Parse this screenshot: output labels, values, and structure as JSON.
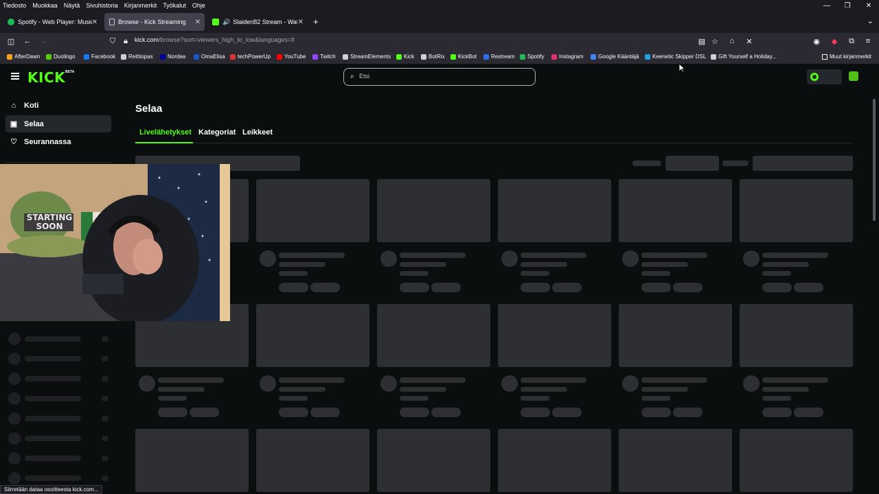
{
  "menubar": {
    "items": [
      "Tiedosto",
      "Muokkaa",
      "Näytä",
      "Sivuhistoria",
      "Kirjanmerkit",
      "Työkalut",
      "Ohje"
    ]
  },
  "tabs": [
    {
      "label": "Spotify - Web Player: Music for",
      "icon": "spotify-icon",
      "active": false
    },
    {
      "label": "Browse - Kick Streaming",
      "icon": "page-icon",
      "active": true
    },
    {
      "label": "Slaideri82 Stream - Watch l",
      "icon": "kick-icon",
      "active": false
    }
  ],
  "urlbar": {
    "host": "kick.com",
    "path": "/browse?sort=viewers_high_to_low&languages=fi"
  },
  "bookmarks": [
    {
      "label": "AfterDawn",
      "color": "#f4a21a"
    },
    {
      "label": "Duolingo",
      "color": "#58cc02"
    },
    {
      "label": "Facebook",
      "color": "#1877f2"
    },
    {
      "label": "Reittiopas",
      "color": "#cfcfd8"
    },
    {
      "label": "Nordea",
      "color": "#0000a0"
    },
    {
      "label": "OmaElisa",
      "color": "#1a57c8"
    },
    {
      "label": "techPowerUp",
      "color": "#d33"
    },
    {
      "label": "YouTube",
      "color": "#ff0000"
    },
    {
      "label": "Twitch",
      "color": "#9146ff"
    },
    {
      "label": "StreamElements",
      "color": "#cfcfd8"
    },
    {
      "label": "Kick",
      "color": "#53fc18"
    },
    {
      "label": "BotRix",
      "color": "#cfcfd8"
    },
    {
      "label": "KickBot",
      "color": "#53fc18"
    },
    {
      "label": "Restream",
      "color": "#2f6fed"
    },
    {
      "label": "Spotify",
      "color": "#1db954"
    },
    {
      "label": "Instagram",
      "color": "#e1306c"
    },
    {
      "label": "Google Kääntäjä",
      "color": "#4285f4"
    },
    {
      "label": "Keenetic Skipper DSL",
      "color": "#1fa3e0"
    },
    {
      "label": "Gift Yourself a Holiday...",
      "color": "#cfcfd8"
    }
  ],
  "bookmarks_other": "Muut kirjanmerkit",
  "kick": {
    "logo": "KICK",
    "logo_badge": "BETA",
    "search_placeholder": "Etsi",
    "brand_color": "#53fc18",
    "sidebar": [
      {
        "label": "Koti",
        "icon": "home-icon",
        "active": false
      },
      {
        "label": "Selaa",
        "icon": "browse-icon",
        "active": true
      },
      {
        "label": "Seurannassa",
        "icon": "heart-icon",
        "active": false
      }
    ],
    "page_title": "Selaa",
    "tabs": [
      {
        "label": "Livelähetykset",
        "active": true
      },
      {
        "label": "Kategoriat",
        "active": false
      },
      {
        "label": "Leikkeet",
        "active": false
      }
    ]
  },
  "status": "Siirretään dataa osoitteesta kick.com..."
}
